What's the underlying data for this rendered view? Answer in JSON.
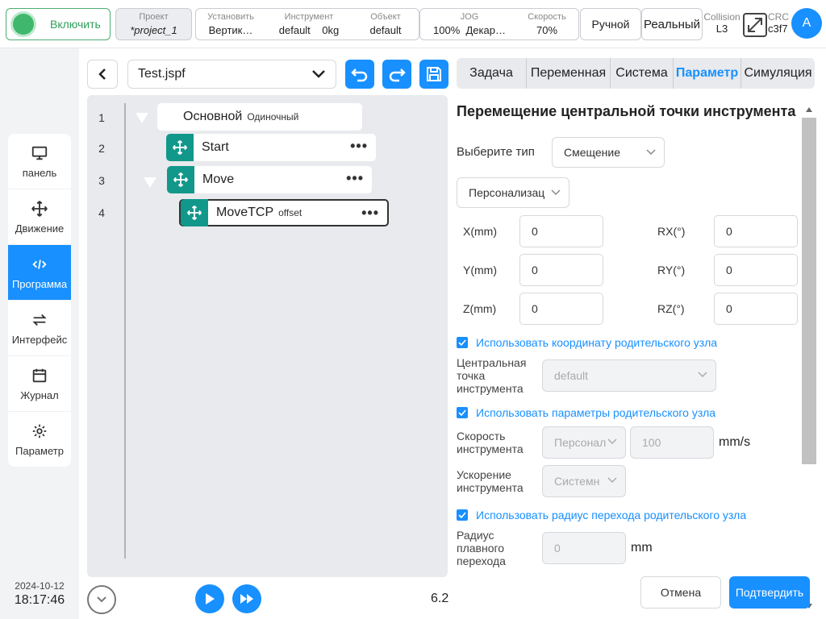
{
  "topbar": {
    "enable_label": "Включить",
    "project": {
      "key": "Проект",
      "value": "*project_1"
    },
    "install": {
      "key": "Установить",
      "value": "Вертик…"
    },
    "tool": {
      "key": "Инструмент",
      "value": "default",
      "payload": "0kg"
    },
    "object": {
      "key": "Объект",
      "value": "default"
    },
    "jog": {
      "key": "JOG",
      "value": "100%",
      "frame": "Декар…"
    },
    "speed": {
      "key": "Скорость",
      "value": "70%"
    },
    "mode_label": "Ручной",
    "env_label": "Реальный",
    "collision": {
      "key": "Collision",
      "value": "L3"
    },
    "crc": {
      "key": "CRC",
      "value": "c3f7"
    },
    "avatar_letter": "A"
  },
  "nav": {
    "items": [
      {
        "label": "панель",
        "icon": "monitor-icon"
      },
      {
        "label": "Движение",
        "icon": "move-icon"
      },
      {
        "label": "Программа",
        "icon": "code-icon",
        "active": true
      },
      {
        "label": "Интерфейс",
        "icon": "swap-icon"
      },
      {
        "label": "Журнал",
        "icon": "calendar-icon"
      },
      {
        "label": "Параметр",
        "icon": "gear-icon"
      }
    ]
  },
  "datetime": {
    "date": "2024-10-12",
    "time": "18:17:46"
  },
  "program": {
    "file_name": "Test.jspf",
    "line_numbers": [
      "1",
      "2",
      "3",
      "4"
    ],
    "nodes": [
      {
        "name": "Основной",
        "sub": "Одиночный"
      },
      {
        "name": "Start"
      },
      {
        "name": "Move"
      },
      {
        "name": "MoveTCP",
        "sub": "offset"
      }
    ],
    "more_glyph": "•••",
    "version": "6.2"
  },
  "tabs": [
    "Задача",
    "Переменная",
    "Система",
    "Параметр",
    "Симуляция"
  ],
  "active_tab": "Параметр",
  "form": {
    "title": "Перемещение центральной точки инструмента",
    "type_label": "Выберите тип",
    "type_value": "Смещение",
    "mode_value": "Персонализац",
    "coords": {
      "x": {
        "label": "X(mm)",
        "value": "0"
      },
      "y": {
        "label": "Y(mm)",
        "value": "0"
      },
      "z": {
        "label": "Z(mm)",
        "value": "0"
      },
      "rx": {
        "label": "RX(°)",
        "value": "0"
      },
      "ry": {
        "label": "RY(°)",
        "value": "0"
      },
      "rz": {
        "label": "RZ(°)",
        "value": "0"
      }
    },
    "use_parent_coord": "Использовать координату родительского узла",
    "tcp_label_1": "Центральная",
    "tcp_label_2": "точка",
    "tcp_label_3": "инструмента",
    "tcp_value": "default",
    "use_parent_params": "Использовать параметры родительского узла",
    "speed_label_1": "Скорость",
    "speed_label_2": "инструмента",
    "speed_mode": "Персонал",
    "speed_value": "100",
    "speed_unit": "mm/s",
    "accel_label_1": "Ускорение",
    "accel_label_2": "инструмента",
    "accel_mode": "Системн",
    "use_parent_radius": "Использовать радиус перехода родительского узла",
    "radius_label_1": "Радиус",
    "radius_label_2": "плавного",
    "radius_label_3": "перехода",
    "radius_value": "0",
    "radius_unit": "mm"
  },
  "buttons": {
    "cancel": "Отмена",
    "confirm": "Подтвердить"
  },
  "colors": {
    "accent": "#1890ff",
    "node_icon": "#12988a",
    "enable_green": "#3fb86b"
  }
}
